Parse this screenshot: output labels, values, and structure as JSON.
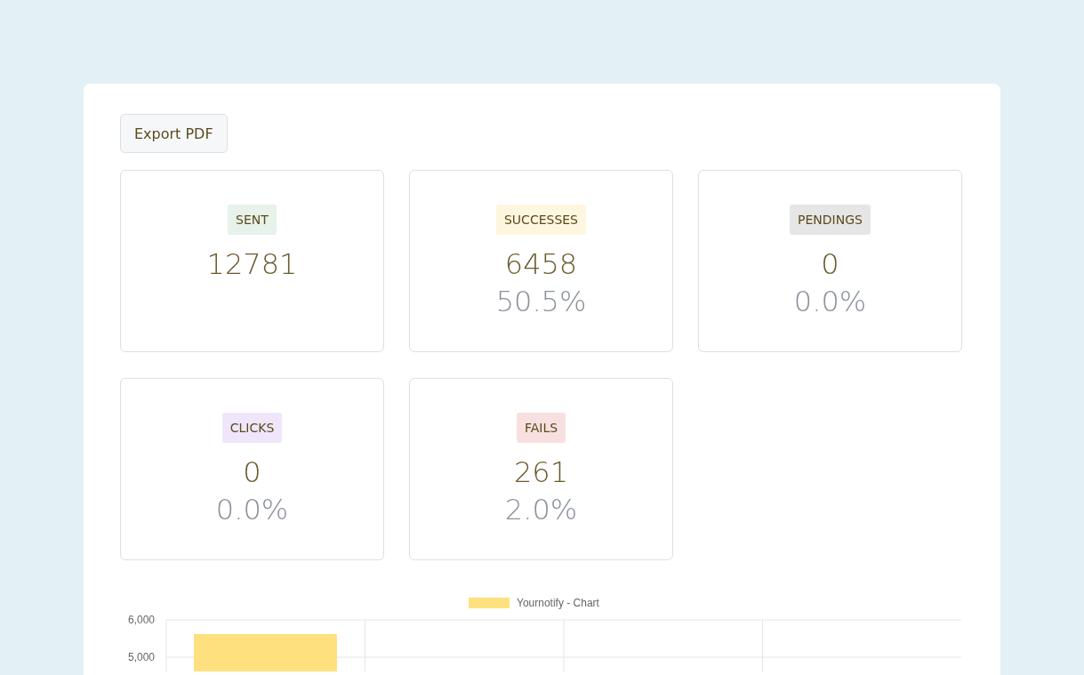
{
  "export_button": {
    "label": "Export PDF"
  },
  "stats": [
    {
      "label": "SENT",
      "color": "#e6f2ea",
      "count": "12781"
    },
    {
      "label": "SUCCESSES",
      "color": "#fff6df",
      "count": "6458",
      "percent": "50.5%"
    },
    {
      "label": "PENDINGS",
      "color": "#e6e6e6",
      "count": "0",
      "percent": "0.0%"
    },
    {
      "label": "CLICKS",
      "color": "#efe6fb",
      "count": "0",
      "percent": "0.0%"
    },
    {
      "label": "FAILS",
      "color": "#f9e0e0",
      "count": "261",
      "percent": "2.0%"
    }
  ],
  "chart": {
    "chart_data": {
      "type": "bar",
      "categories": [
        null,
        null,
        null,
        null
      ],
      "series": [
        {
          "name": "Yournotify - Chart",
          "color": "#ffe07e",
          "values": [
            5620,
            null,
            null,
            null
          ]
        }
      ],
      "ylim": [
        4619,
        6000
      ],
      "yticks": [
        {
          "value": 5000,
          "label": "5,000"
        },
        {
          "value": 6000,
          "label": "6,000"
        }
      ]
    }
  }
}
